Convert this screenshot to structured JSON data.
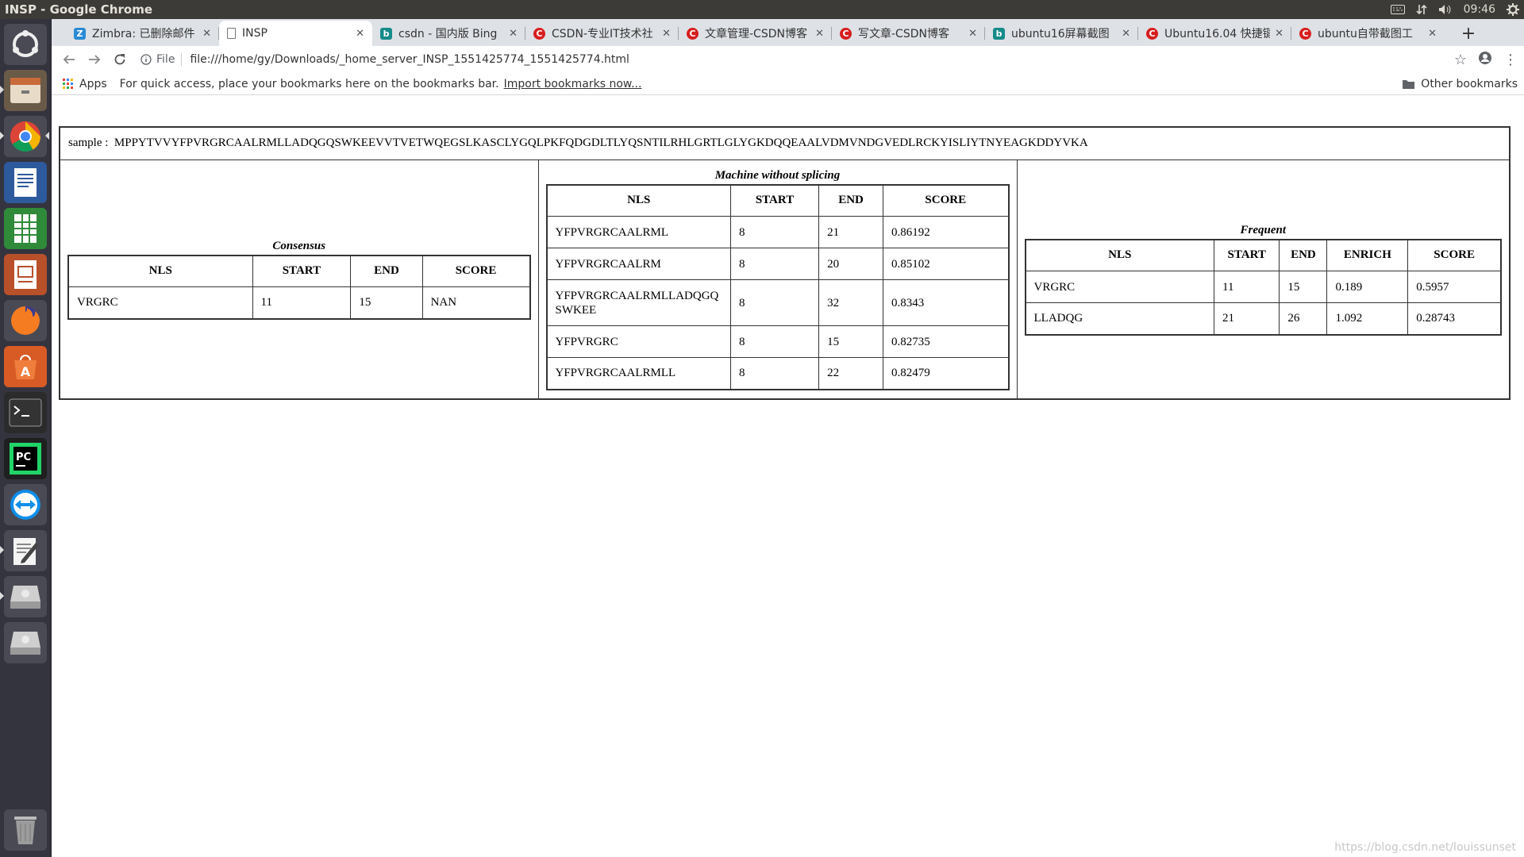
{
  "panel": {
    "window_title": "INSP - Google Chrome",
    "time": "09:46"
  },
  "tabs": [
    {
      "label": "Zimbra: 已删除邮件",
      "icon": "zimbra-icon",
      "color": "#2a8ad4",
      "glyph": "Z"
    },
    {
      "label": "INSP",
      "icon": "file-icon",
      "color": "#ffffff",
      "glyph": ""
    },
    {
      "label": "csdn - 国内版 Bing",
      "icon": "bing-icon",
      "color": "#168b8a",
      "glyph": "b"
    },
    {
      "label": "CSDN-专业IT技术社",
      "icon": "csdn-icon",
      "color": "#d71e1e",
      "glyph": "C"
    },
    {
      "label": "文章管理-CSDN博客",
      "icon": "csdn-icon",
      "color": "#d71e1e",
      "glyph": "C"
    },
    {
      "label": "写文章-CSDN博客",
      "icon": "csdn-icon",
      "color": "#d71e1e",
      "glyph": "C"
    },
    {
      "label": "ubuntu16屏幕截图",
      "icon": "bing-icon",
      "color": "#168b8a",
      "glyph": "b"
    },
    {
      "label": "Ubuntu16.04 快捷键",
      "icon": "csdn-icon",
      "color": "#d71e1e",
      "glyph": "C"
    },
    {
      "label": "ubuntu自带截图工",
      "icon": "csdn-icon",
      "color": "#d71e1e",
      "glyph": "C"
    }
  ],
  "toolbar": {
    "chip_label": "File",
    "url": "file:///home/gy/Downloads/_home_server_INSP_1551425774_1551425774.html"
  },
  "bookmarks": {
    "apps_label": "Apps",
    "hint": "For quick access, place your bookmarks here on the bookmarks bar.",
    "import_link": "Import bookmarks now...",
    "other": "Other bookmarks"
  },
  "page": {
    "sample_label": "sample :",
    "sample_seq": "MPPYTVVYFPVRGRCAALRMLLADQGQSWKEEVVTVETWQEGSLKASCLYGQLPKFQDGDLTLYQSNTILRHLGRTLGLYGKDQQEAALVDMVNDGVEDLRCKYISLIYTNYEAGKDDYVKA",
    "consensus": {
      "title": "Consensus",
      "headers": [
        "NLS",
        "START",
        "END",
        "SCORE"
      ],
      "rows": [
        [
          "VRGRC",
          "11",
          "15",
          "NAN"
        ]
      ]
    },
    "machine": {
      "title": "Machine without splicing",
      "headers": [
        "NLS",
        "START",
        "END",
        "SCORE"
      ],
      "rows": [
        [
          "YFPVRGRCAALRML",
          "8",
          "21",
          "0.86192"
        ],
        [
          "YFPVRGRCAALRM",
          "8",
          "20",
          "0.85102"
        ],
        [
          "YFPVRGRCAALRMLLADQGQSWKEE",
          "8",
          "32",
          "0.8343"
        ],
        [
          "YFPVRGRC",
          "8",
          "15",
          "0.82735"
        ],
        [
          "YFPVRGRCAALRMLL",
          "8",
          "22",
          "0.82479"
        ]
      ]
    },
    "frequent": {
      "title": "Frequent",
      "headers": [
        "NLS",
        "START",
        "END",
        "ENRICH",
        "SCORE"
      ],
      "rows": [
        [
          "VRGRC",
          "11",
          "15",
          "0.189",
          "0.5957"
        ],
        [
          "LLADQG",
          "21",
          "26",
          "1.092",
          "0.28743"
        ]
      ]
    }
  },
  "watermark": "https://blog.csdn.net/louissunset"
}
